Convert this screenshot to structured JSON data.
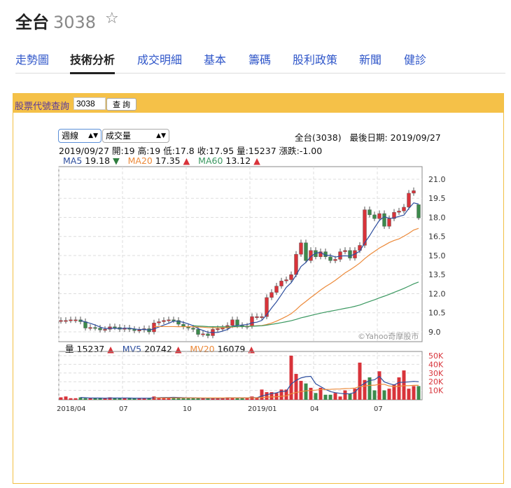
{
  "header": {
    "name": "全台",
    "code": "3038"
  },
  "tabs": [
    "走勢圖",
    "技術分析",
    "成交明細",
    "基本",
    "籌碼",
    "股利政策",
    "新聞",
    "健診"
  ],
  "search": {
    "label": "股票代號查詢",
    "value": "3038",
    "button": "查 詢"
  },
  "controls": {
    "period": "週線",
    "indicator": "成交量"
  },
  "info": {
    "stock": "全台(3038)",
    "last_date": "最後日期: 2019/09/27",
    "ohlc": "2019/09/27 開:19 高:19 低:17.8 收:17.95 量:15237 漲跌:-1.00",
    "ma5_label": "MA5",
    "ma5": "19.18",
    "ma20_label": "MA20",
    "ma20": "17.35",
    "ma60_label": "MA60",
    "ma60": "13.12",
    "vol_label": "量",
    "vol": "15237",
    "mv5_label": "MV5",
    "mv5": "20742",
    "mv20_label": "MV20",
    "mv20": "16079",
    "watermark": "©Yahoo奇摩股市"
  },
  "colors": {
    "up": "#d8333a",
    "down": "#3c8a4c",
    "ma5": "#2d4e9e",
    "ma20": "#ec8a3a",
    "ma60": "#3a9860"
  },
  "chart_data": {
    "type": "candlestick",
    "price_ticks": [
      "21.0",
      "19.5",
      "18.0",
      "16.5",
      "15.0",
      "13.5",
      "12.0",
      "10.5",
      "9.0"
    ],
    "price_range": [
      9.0,
      21.0
    ],
    "vol_ticks": [
      "50K",
      "40K",
      "30K",
      "20K",
      "10K"
    ],
    "x_ticks": [
      {
        "label": "2018/04",
        "week": 0
      },
      {
        "label": "07",
        "week": 13
      },
      {
        "label": "10",
        "week": 26
      },
      {
        "label": "2019/01",
        "week": 39
      },
      {
        "label": "04",
        "week": 52
      },
      {
        "label": "07",
        "week": 65
      }
    ],
    "close": [
      9.9,
      9.9,
      9.95,
      9.95,
      9.8,
      9.3,
      9.35,
      9.3,
      9.15,
      9.2,
      9.4,
      9.35,
      9.2,
      9.3,
      9.2,
      9.1,
      9.15,
      9.25,
      9.0,
      9.7,
      9.8,
      9.9,
      9.95,
      9.9,
      9.6,
      9.4,
      9.3,
      9.2,
      8.8,
      8.85,
      8.7,
      9.2,
      9.25,
      9.3,
      9.5,
      9.95,
      9.5,
      9.45,
      9.45,
      10.2,
      10.2,
      10.2,
      11.7,
      12.1,
      12.6,
      13.0,
      13.1,
      13.5,
      15.1,
      16.0,
      14.6,
      15.4,
      14.9,
      15.3,
      14.9,
      14.6,
      14.7,
      15.3,
      15.4,
      14.8,
      15.4,
      15.8,
      18.6,
      18.2,
      17.9,
      18.3,
      17.3,
      17.9,
      18.4,
      18.5,
      18.8,
      19.9,
      20.1,
      17.95
    ],
    "last_open": 19,
    "last_high": 19,
    "last_low": 17.8,
    "volume_k": [
      2,
      3,
      1,
      1,
      2,
      1,
      1,
      1,
      1,
      1,
      2,
      1,
      1,
      1,
      1,
      1,
      1,
      1,
      1,
      3,
      2,
      2,
      1,
      2,
      2,
      1,
      1,
      1,
      1,
      1,
      1,
      1,
      1,
      1,
      2,
      2,
      1,
      1,
      1,
      3,
      2,
      11,
      8,
      8,
      7,
      11,
      11,
      50,
      29,
      21,
      18,
      13,
      7,
      13,
      5,
      5,
      7,
      3,
      10,
      6,
      12,
      42,
      22,
      25,
      10,
      32,
      10,
      12,
      17,
      25,
      33,
      12,
      15,
      15
    ]
  }
}
